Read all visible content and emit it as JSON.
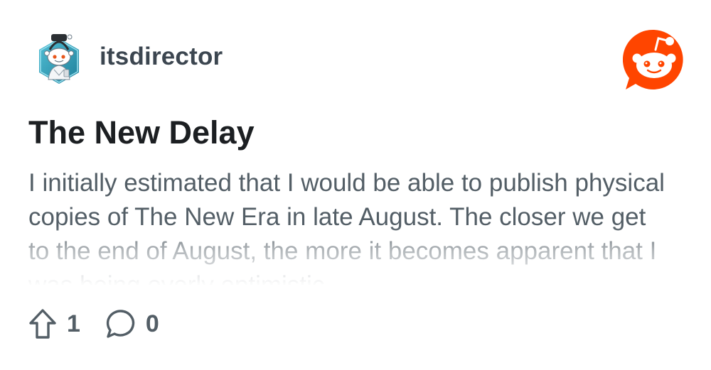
{
  "post": {
    "author": "itsdirector",
    "title": "The New Delay",
    "body": "I initially estimated that I would be able to publish physical copies of The New Era in late August. The closer we get to the end of August, the more it becomes apparent that I was being overly optimistic.",
    "upvotes": "1",
    "comments": "0"
  },
  "icons": {
    "avatar": "snoo-avatar-icon",
    "logo": "reddit-logo-icon",
    "upvote": "upvote-arrow-icon",
    "comment": "comment-bubble-icon"
  },
  "colors": {
    "brand": "#ff4500",
    "avatar_bg": "#2a9bb3",
    "title": "#1c1f22",
    "body": "#535e66"
  }
}
